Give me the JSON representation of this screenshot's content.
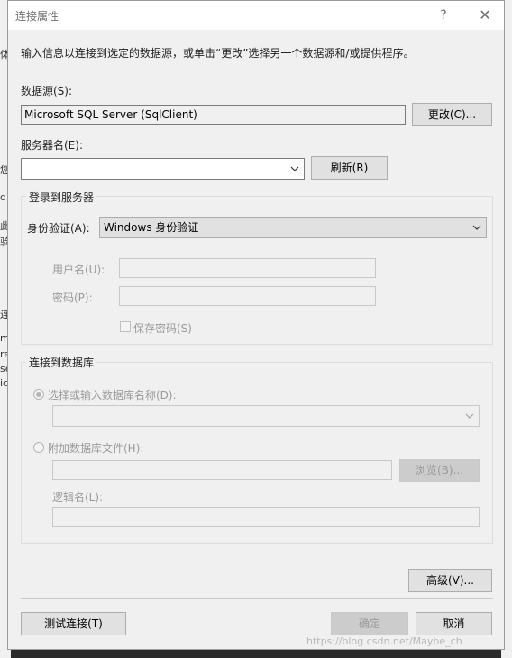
{
  "window": {
    "title": "连接属性",
    "help_glyph": "?",
    "close_glyph": "✕"
  },
  "background": {
    "fragments": [
      "体",
      "d",
      "您",
      "此",
      "验",
      "连",
      "m",
      "re",
      "se",
      "ic"
    ]
  },
  "intro": "输入信息以连接到选定的数据源，或单击“更改”选择另一个数据源和/或提供程序。",
  "datasource": {
    "label": "数据源(S):",
    "value": "Microsoft SQL Server (SqlClient)",
    "change_button": "更改(C)..."
  },
  "server": {
    "label": "服务器名(E):",
    "value": "",
    "refresh_button": "刷新(R)"
  },
  "login_group": {
    "title": "登录到服务器",
    "auth_label": "身份验证(A):",
    "auth_value": "Windows 身份验证",
    "username_label": "用户名(U):",
    "username_value": "",
    "password_label": "密码(P):",
    "password_value": "",
    "save_password_label": "保存密码(S)",
    "save_password_checked": false
  },
  "db_group": {
    "title": "连接到数据库",
    "select_db_label": "选择或输入数据库名称(D):",
    "select_db_value": "",
    "attach_label": "附加数据库文件(H):",
    "attach_value": "",
    "browse_button": "浏览(B)...",
    "logical_name_label": "逻辑名(L):",
    "logical_name_value": ""
  },
  "buttons": {
    "advanced": "高级(V)...",
    "test": "测试连接(T)",
    "ok": "确定",
    "cancel": "取消"
  },
  "watermark": "https://blog.csdn.net/Maybe_ch",
  "colors": {
    "dialog_bg": "#f0f0f0",
    "button_bg": "#e1e1e1",
    "disabled_text": "#9a9a9a"
  }
}
